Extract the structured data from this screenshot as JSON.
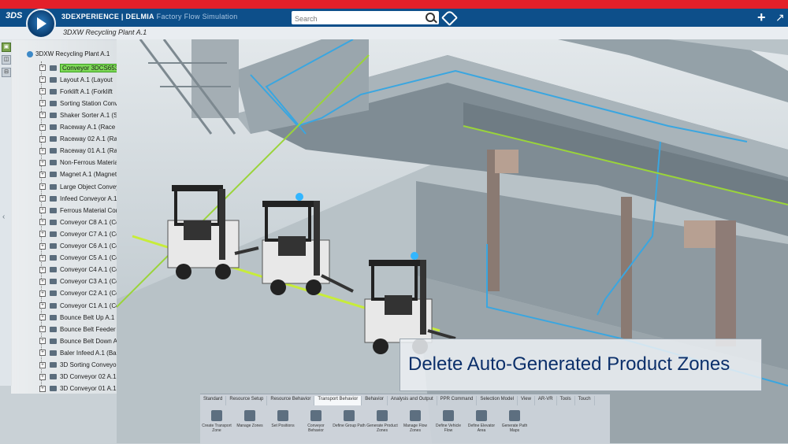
{
  "app": {
    "brand": "3DEXPERIENCE | DELMIA",
    "subtitle": "Factory Flow Simulation",
    "logo": "3DS",
    "search_placeholder": "Search",
    "document_tab": "3DXW Recycling Plant A.1"
  },
  "tree": {
    "root": "3DXW Recycling Plant A.1",
    "items": [
      {
        "label": "Conveyor 3DCS6530 A.1"
      },
      {
        "label": "Layout A.1 (Layout"
      },
      {
        "label": "Forklift A.1 (Forklift"
      },
      {
        "label": "Sorting Station Conv"
      },
      {
        "label": "Shaker Sorter A.1 (Sh"
      },
      {
        "label": "Raceway A.1 (Race"
      },
      {
        "label": "Raceway 02 A.1 (Rac"
      },
      {
        "label": "Raceway 01 A.1 (Rac"
      },
      {
        "label": "Non-Ferrous Materia"
      },
      {
        "label": "Magnet A.1 (Magnet"
      },
      {
        "label": "Large Object Conveyo"
      },
      {
        "label": "Infeed Conveyor A.1"
      },
      {
        "label": "Ferrous Material Con"
      },
      {
        "label": "Conveyor C8 A.1 (Co"
      },
      {
        "label": "Conveyor C7 A.1 (Co"
      },
      {
        "label": "Conveyor C6 A.1 (Co"
      },
      {
        "label": "Conveyor C5 A.1 (Co"
      },
      {
        "label": "Conveyor C4 A.1 (Co"
      },
      {
        "label": "Conveyor C3 A.1 (Co"
      },
      {
        "label": "Conveyor C2 A.1 (Co"
      },
      {
        "label": "Conveyor C1 A.1 (Co"
      },
      {
        "label": "Bounce Belt Up A.1 (B"
      },
      {
        "label": "Bounce Belt Feeder A"
      },
      {
        "label": "Bounce Belt Down A.1"
      },
      {
        "label": "Baler Infeed A.1 (Bal"
      },
      {
        "label": "3D Sorting Conveyor"
      },
      {
        "label": "3D Conveyor 02 A.1 ("
      },
      {
        "label": "3D Conveyor 01 A.1 ("
      }
    ]
  },
  "caption": "Delete Auto-Generated Product Zones",
  "toolbar": {
    "tabs": [
      "Standard",
      "Resource Setup",
      "Resource Behavior",
      "Transport Behavior",
      "Behavior",
      "Analysis and Output",
      "PPR Command",
      "Selection Model",
      "View",
      "AR-VR",
      "Tools",
      "Touch"
    ],
    "active_tab": 3,
    "tools": [
      "Create Transport Zone",
      "Manage Zones",
      "Set Positions",
      "Conveyor Behavior",
      "Define Group Path",
      "Generate Product Zones",
      "Manage Flow Zones",
      "Define Vehicle Flow",
      "Define Elevator Area",
      "Generate Path Maps"
    ]
  },
  "colors": {
    "accent": "#0d4f8a",
    "topline": "#e4202a",
    "selection": "#7ed957",
    "caption_text": "#0b2f6a"
  }
}
